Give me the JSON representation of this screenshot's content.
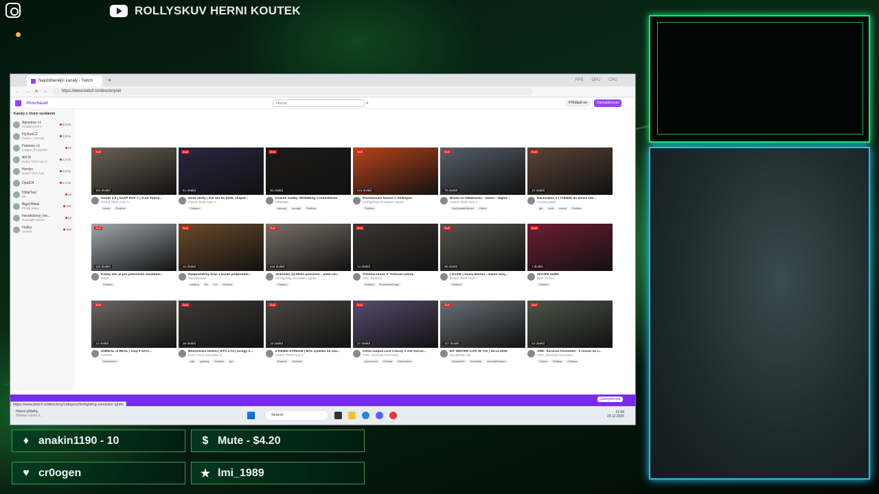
{
  "overlay": {
    "channel_title": "ROLLYSKUV HERNI KOUTEK",
    "alerts": [
      {
        "icon": "diamond-icon",
        "glyph": "♦",
        "text": "anakin1190 - 10"
      },
      {
        "icon": "dollar-icon",
        "glyph": "$",
        "text": "Mute - $4.20"
      },
      {
        "icon": "heart-icon",
        "glyph": "♥",
        "text": "cr0ogen"
      },
      {
        "icon": "star-icon",
        "glyph": "★",
        "text": "lmi_1989"
      }
    ]
  },
  "browser": {
    "tab_title": "Nejoblíbenější kanály - Twitch",
    "url": "https://www.twitch.tv/directory/all",
    "stats": [
      "FPS",
      "GPU",
      "CPU"
    ],
    "status_url": "https://www.twitch.tv/directory/category/firefighting-simulator-ignite"
  },
  "twitch": {
    "browse": "Procházet",
    "search_placeholder": "Hledat",
    "login": "Přihlásit se",
    "signup": "Zaregistrovat",
    "sidebar_header": "Kanály s živým vysíláním",
    "sidebar": [
      {
        "name": "Agnestus +1",
        "cat": "Resident Evil 5",
        "v": "3,5 tis."
      },
      {
        "name": "FlyGunCZ",
        "cat": "Games + Demos",
        "v": "1,9 tis."
      },
      {
        "name": "Falanxry +1",
        "cat": "League of Legends",
        "v": "22"
      },
      {
        "name": "AllTIX",
        "cat": "Grand Theft Auto V",
        "v": "1,2 tis."
      },
      {
        "name": "Herdyn",
        "cat": "Grand Theft Auto",
        "v": "1,6 tis."
      },
      {
        "name": "OpatO4",
        "cat": "",
        "v": "1,2 tis."
      },
      {
        "name": "5StarTaxi",
        "cat": "IRL",
        "v": "34"
      },
      {
        "name": "BigeOfficial",
        "cat": "Prostě pokec",
        "v": "201"
      },
      {
        "name": "hvezdickovy_hm...",
        "cat": "Teamfight Tactics",
        "v": "52"
      },
      {
        "name": "Fluffcz",
        "cat": "Unheim",
        "v": "240"
      }
    ],
    "banner_button": "Zaregistrovat",
    "rows": [
      [
        {
          "views": "101 diváků",
          "title": "GomK 2.0 | SASP POV + | V-All Tonny...",
          "cat": "Grand Theft Auto V",
          "tags": [
            "česky",
            "Čeština"
          ],
          "color": "#6b6255"
        },
        {
          "views": "51 diváků",
          "title": "Nové alerty | Pár dní do 2026, chapet...",
          "cat": "Grand Theft Auto V",
          "tags": [
            "Čeština"
          ],
          "color": "#2b2540"
        },
        {
          "views": "30 diváků",
          "title": "Krásné svátky !!RONHing u hraní♥Ones",
          "cat": "MIMOBS",
          "tags": [
            "kenpay",
            "czsvgei",
            "Čeština"
          ],
          "color": "#1c1a18"
        },
        {
          "views": "641 diváků",
          "title": "Povrážování hasičů s Andrejem",
          "cat": "Firefighting Simulator: Ignite",
          "tags": [
            "Čeština"
          ],
          "color": "#b8431c"
        },
        {
          "views": "79 diváků",
          "title": "Brodá na GENKáčku - umíící - slajtní...",
          "cat": "Grand Theft Auto V",
          "tags": [
            "1opQualityStream",
            "Hefco"
          ],
          "color": "#56606a"
        },
        {
          "views": "10 diváků",
          "title": "Nachcilíme ♥ | 176/600 do konce rok...",
          "cat": "Prostě pokec",
          "tags": [
            "girl",
            "czsk",
            "czech",
            "Čeština"
          ],
          "color": "#5a4436"
        }
      ],
      [
        {
          "views": "123 diváků",
          "title": "Každý den je pro přeživšího začátkem...",
          "cat": "DayZ",
          "tags": [
            "Čeština"
          ],
          "color": "#9fa8ad"
        },
        {
          "views": "12 diváků",
          "title": "Nadprůměrný hráč v každé podprůměr...",
          "cat": "Hearthstone",
          "tags": [
            "cestina",
            "SK",
            "CZ",
            "Čeština"
          ],
          "color": "#6a4a2a"
        },
        {
          "views": "844 diváků",
          "title": "Jednotka rychlého posezení... aneb vel...",
          "cat": "Firefighting Simulator: Ignite",
          "tags": [
            "Čeština"
          ],
          "color": "#7a7168"
        },
        {
          "views": "14 diváků",
          "title": "Trefovat hráče ✕ Trefovat roboty",
          "cat": "ARC Raiders",
          "tags": [
            "Čeština",
            "ProvinnedOrigin"
          ],
          "color": "#3a3632"
        },
        {
          "views": "88 diváků",
          "title": "| GomK | Giulia Baroni - mámu dvoj...",
          "cat": "Grand Theft Auto V",
          "tags": [
            "Čeština"
          ],
          "color": "#55544c"
        },
        {
          "views": "7 diváků",
          "title": "267/300 SUBS",
          "cat": "Split Fiction",
          "tags": [
            "Čeština"
          ],
          "color": "#6e1d34"
        }
      ],
      [
        {
          "views": "14 diváků",
          "title": "UNREAL is REAL | !clip ♥ SAC!...",
          "cat": "Fortnite",
          "tags": [
            "Slovenčina"
          ],
          "color": "#6a6864"
        },
        {
          "views": "38 diváků",
          "title": "Bežneníčko bežení | ETS 2.#3 | scingy n...",
          "cat": "Euro Truck Simulator 2",
          "tags": [
            "talk",
            "gaming",
            "Čeština",
            "girl"
          ],
          "color": "#3c3a38"
        },
        {
          "views": "10 diváků",
          "title": "5 DENNÍ STREAM | 50% výdelku na cha...",
          "cat": "Grand Theft Auto V",
          "tags": [
            "Esports",
            "Čeština"
          ],
          "color": "#4a4844"
        },
        {
          "views": "27 diváků",
          "title": "Cesta mapou Lost Colony !! Ark Surviv...",
          "cat": "ARK: Survival Ascended",
          "tags": [
            "sponzored",
            "Čeština",
            "Slovenčina"
          ],
          "color": "#5a4a6e"
        },
        {
          "views": "127 diváků",
          "title": "MY WINTER CAR JE TU! | 29.12.2025",
          "cat": "My Winter Car",
          "tags": [
            "Syncrek11",
            "Kamiolak",
            "GoesteFarteen"
          ],
          "color": "#687078"
        },
        {
          "views": "24 diváků",
          "title": "ARK: Survival Ascended - S rexem na v...",
          "cat": "ARK: Survival Ascended",
          "tags": [
            "10plus",
            "Čeština",
            "Čeština"
          ],
          "color": "#4e5548"
        }
      ]
    ]
  },
  "taskbar": {
    "weather_title": "Hlavní příběhy",
    "weather_sub": "Zhlava v první li...",
    "search": "Search",
    "time": "21:58",
    "date": "29.12.2025"
  }
}
